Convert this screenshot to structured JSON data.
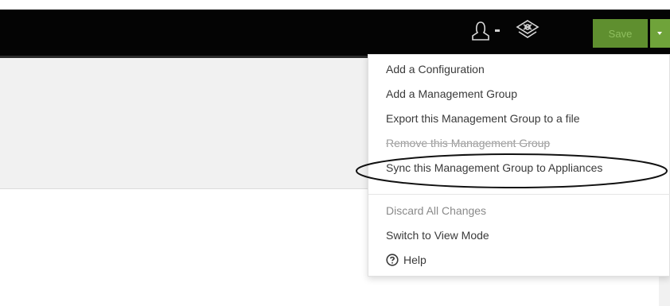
{
  "toolbar": {
    "user_icon": "user-icon",
    "settings_icon": "settings-icon",
    "save_label": "Save",
    "save_color": "#5f8f2f",
    "save_dropdown_icon": "chevron-down-icon"
  },
  "dropdown": {
    "items": [
      {
        "label": "Add a Configuration",
        "state": "normal"
      },
      {
        "label": "Add a Management Group",
        "state": "normal"
      },
      {
        "label": "Export this Management Group to a file",
        "state": "normal"
      },
      {
        "label": "Remove this Management Group",
        "state": "disabled"
      },
      {
        "label": "Sync this Management Group to Appliances",
        "state": "highlighted"
      }
    ],
    "secondary_items": [
      {
        "label": "Discard All Changes",
        "state": "muted"
      },
      {
        "label": "Switch to View Mode",
        "state": "normal"
      }
    ],
    "help": {
      "label": "Help",
      "icon": "help-icon"
    }
  }
}
